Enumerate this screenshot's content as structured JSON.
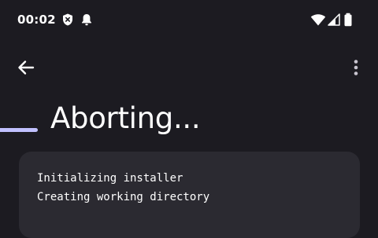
{
  "status_bar": {
    "time": "00:02",
    "icons": [
      "shield-x-icon",
      "bell-icon",
      "wifi-icon",
      "cell-signal-icon",
      "battery-icon"
    ]
  },
  "toolbar": {
    "back_icon": "arrow-left-icon",
    "more_icon": "more-vert-icon"
  },
  "page": {
    "title": "Aborting..."
  },
  "progress": {
    "value_fraction": 0.1,
    "color": "#c1c1ff"
  },
  "log": {
    "lines": [
      "Initializing installer",
      "Creating working directory"
    ]
  },
  "colors": {
    "background": "#1c1b21",
    "card": "#2b2a31",
    "text": "#ffffff"
  }
}
